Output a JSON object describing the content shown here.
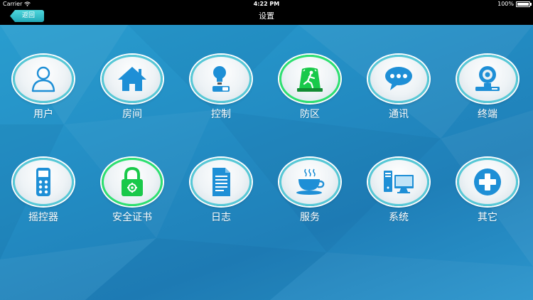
{
  "statusbar": {
    "carrier": "Carrier",
    "time": "4:22 PM",
    "battery": "100%"
  },
  "navbar": {
    "back_label": "返回",
    "title": "设置"
  },
  "colors": {
    "accent": "#1e8fd6",
    "ring": "#57c8d6",
    "ring_active": "#2ee070"
  },
  "items": [
    {
      "label": "用户",
      "icon": "user-icon"
    },
    {
      "label": "房间",
      "icon": "home-icon"
    },
    {
      "label": "控制",
      "icon": "bulb-switch-icon"
    },
    {
      "label": "防区",
      "icon": "alarm-zone-icon"
    },
    {
      "label": "通讯",
      "icon": "chat-bubble-icon"
    },
    {
      "label": "终端",
      "icon": "webcam-icon"
    },
    {
      "label": "摇控器",
      "icon": "remote-control-icon"
    },
    {
      "label": "安全证书",
      "icon": "lock-icon"
    },
    {
      "label": "日志",
      "icon": "log-document-icon"
    },
    {
      "label": "服务",
      "icon": "coffee-cup-icon"
    },
    {
      "label": "系统",
      "icon": "computer-icon"
    },
    {
      "label": "其它",
      "icon": "plus-cross-icon"
    }
  ]
}
